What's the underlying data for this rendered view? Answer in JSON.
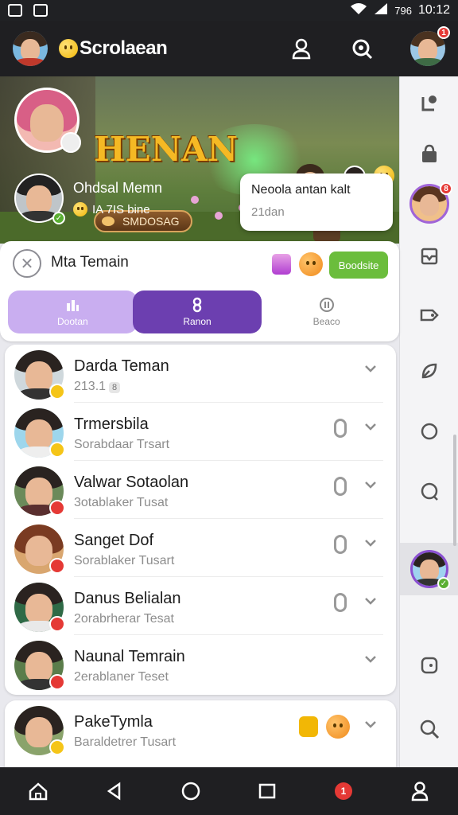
{
  "status_bar": {
    "battery": "796",
    "time": "10:12"
  },
  "app_bar": {
    "title": "Scrolaean",
    "profile_badge": "1"
  },
  "hero": {
    "title": "HENAN",
    "tag": "SMDOSAG",
    "friend_name": "Ohdsal Memn",
    "friend_status": "IA 7IS bine",
    "bubble_title": "Neoola antan kalt",
    "bubble_sub": "21dan"
  },
  "panel": {
    "title": "Mta Temain",
    "action_label": "Boodsite",
    "tabs": [
      {
        "label": "Dootan"
      },
      {
        "label": "Ranon"
      },
      {
        "label": "Beaco"
      }
    ]
  },
  "contacts": [
    {
      "name": "Darda Teman",
      "sub": "213.1",
      "chip": "8",
      "status_color": "#f5c518",
      "has_mic": false
    },
    {
      "name": "Trmersbila",
      "sub": "Sorabdaar Trsart",
      "status_color": "#f5c518",
      "has_mic": true
    },
    {
      "name": "Valwar Sotaolan",
      "sub": "3otablaker Tusat",
      "status_color": "#e53935",
      "has_mic": true
    },
    {
      "name": "Sanget Dof",
      "sub": "Sorablaker Tusart",
      "status_color": "#e53935",
      "has_mic": true
    },
    {
      "name": "Danus Belialan",
      "sub": "2orabrherar Tesat",
      "status_color": "#e53935",
      "has_mic": true
    },
    {
      "name": "Naunal Temrain",
      "sub": "2erablaner Teset",
      "status_color": "#e53935",
      "has_mic": false
    }
  ],
  "contacts_second": [
    {
      "name": "PakeTymla",
      "sub": "Baraldetrer Tusart",
      "status_color": "#f5c518"
    }
  ],
  "sidebar": {
    "icons": [
      "user-tag-icon",
      "shop-bag-icon",
      "avatar",
      "inbox-icon",
      "tag-icon",
      "leaf-icon",
      "circle-icon",
      "search-icon",
      "avatar",
      "comment-icon",
      "search-icon"
    ]
  },
  "nav_badge": "1",
  "colors": {
    "accent": "#6c3fb0",
    "accent_light": "#c9aef0",
    "success": "#6bbd3c",
    "danger": "#e53935"
  }
}
